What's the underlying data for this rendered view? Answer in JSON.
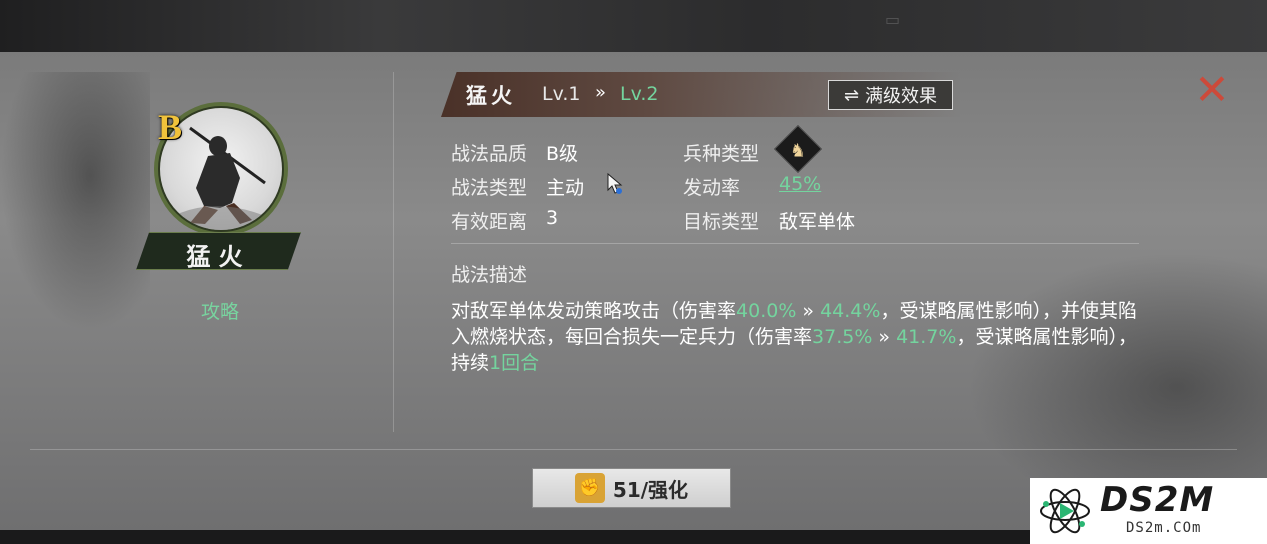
{
  "skill": {
    "name": "猛火",
    "grade_badge": "B",
    "strategy_link": "攻略",
    "level_current": "Lv.1",
    "level_arrow": "»",
    "level_next": "Lv.2",
    "max_level_button": "满级效果",
    "max_level_icon": "⇌",
    "close_icon": "✕"
  },
  "info": {
    "quality_label": "战法品质",
    "quality_value": "B级",
    "type_label": "战法类型",
    "type_value": "主动",
    "range_label": "有效距离",
    "range_value": "3",
    "troop_label": "兵种类型",
    "troop_icon": "♞",
    "rate_label": "发动率",
    "rate_value": "45%",
    "target_label": "目标类型",
    "target_value": "敌军单体"
  },
  "description": {
    "title": "战法描述",
    "p1": "对敌军单体发动策略攻击（伤害率",
    "v1": "40.0%",
    "a1": " » ",
    "v2": "44.4%",
    "p2": "，受谋略属性影响），并使其陷入燃烧状态，每回合损失一定兵力（伤害率",
    "v3": "37.5%",
    "a2": " » ",
    "v4": "41.7%",
    "p3": "，受谋略属性影响），持续",
    "v5": "1回合"
  },
  "enhance": {
    "label": "51/强化",
    "icon": "✊"
  },
  "watermark": {
    "brand": "DS2M",
    "url": "DS2m.COm"
  },
  "colors": {
    "accent_green": "#74d49e",
    "close_red": "#cc4a3a",
    "badge_gold": "#f0c23b"
  }
}
